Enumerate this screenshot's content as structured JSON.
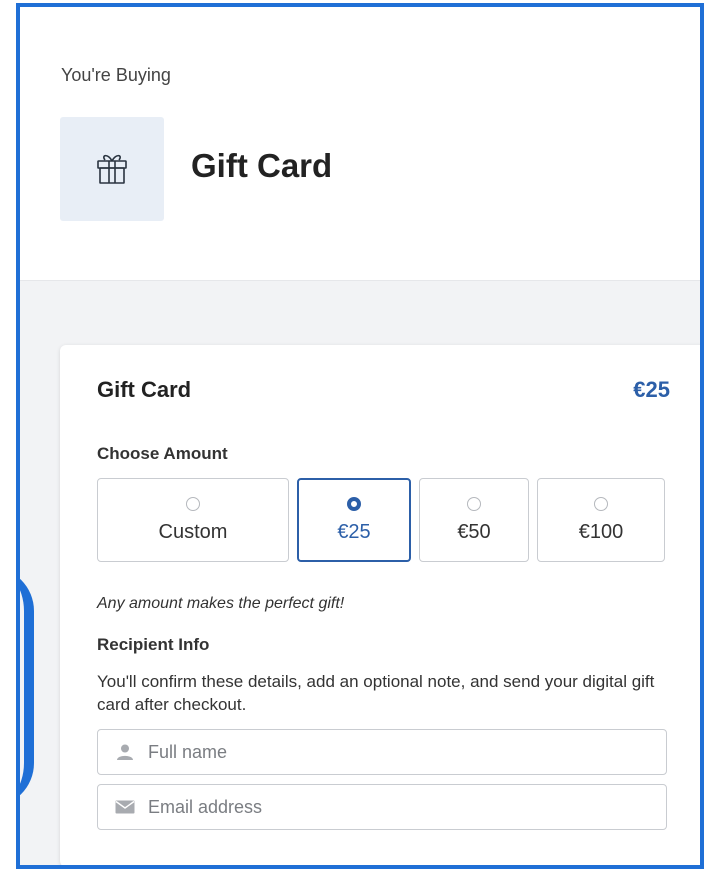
{
  "header": {
    "eyebrow": "You're Buying",
    "product_icon": "gift-icon",
    "product_title": "Gift Card"
  },
  "card": {
    "title": "Gift Card",
    "price": "€25",
    "choose_amount_label": "Choose Amount",
    "amount_options": [
      {
        "label": "Custom",
        "selected": false
      },
      {
        "label": "€25",
        "selected": true
      },
      {
        "label": "€50",
        "selected": false
      },
      {
        "label": "€100",
        "selected": false
      }
    ],
    "tagline": "Any amount makes the perfect gift!",
    "recipient_label": "Recipient Info",
    "recipient_description": "You'll confirm these details, add an optional note, and send your digital gift card after checkout.",
    "fields": {
      "full_name": {
        "placeholder": "Full name",
        "value": "",
        "icon": "user-icon"
      },
      "email": {
        "placeholder": "Email address",
        "value": "",
        "icon": "envelope-icon"
      }
    }
  },
  "colors": {
    "accent": "#2c5fa8",
    "frame_border": "#1f6fd6",
    "page_background": "#f2f3f5"
  }
}
